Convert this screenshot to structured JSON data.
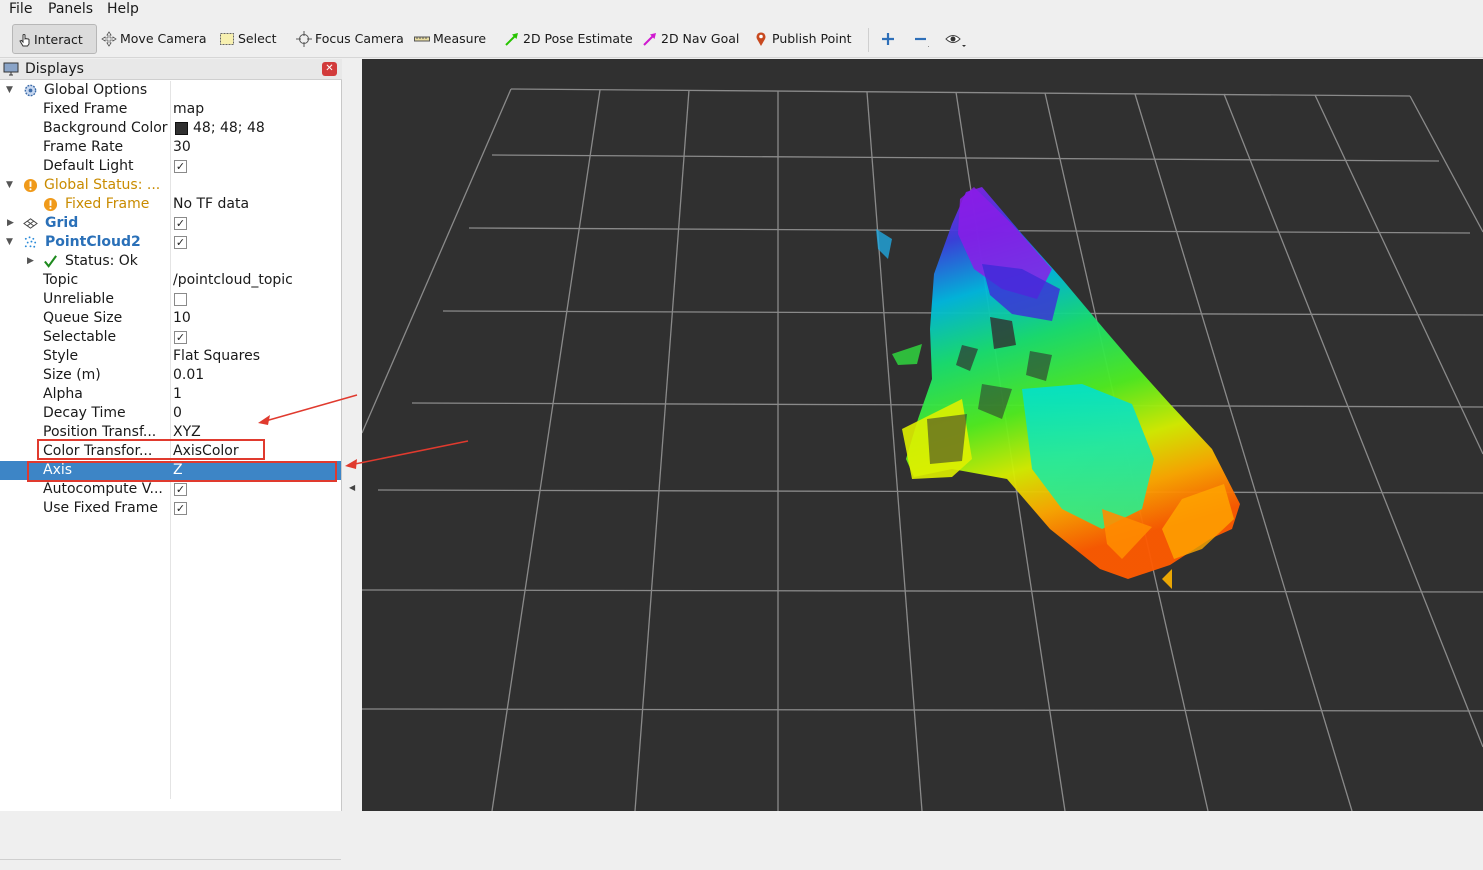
{
  "menu": [
    "File",
    "Panels",
    "Help"
  ],
  "toolbar": {
    "interact": "Interact",
    "move_camera": "Move Camera",
    "select": "Select",
    "focus_camera": "Focus Camera",
    "measure": "Measure",
    "pose_estimate": "2D Pose Estimate",
    "nav_goal": "2D Nav Goal",
    "publish_point": "Publish Point"
  },
  "displays": {
    "title": "Displays",
    "global_options": {
      "label": "Global Options",
      "fixed_frame_key": "Fixed Frame",
      "fixed_frame_val": "map",
      "bg_color_key": "Background Color",
      "bg_color_val": "48; 48; 48",
      "frame_rate_key": "Frame Rate",
      "frame_rate_val": "30",
      "default_light_key": "Default Light",
      "default_light_checked": true
    },
    "global_status": {
      "label": "Global Status: ...",
      "fixed_frame_key": "Fixed Frame",
      "fixed_frame_val": "No TF data"
    },
    "grid": {
      "label": "Grid",
      "checked": true
    },
    "pointcloud": {
      "label": "PointCloud2",
      "checked": true,
      "status": "Status: Ok",
      "topic_key": "Topic",
      "topic_val": "/pointcloud_topic",
      "unreliable_key": "Unreliable",
      "unreliable_checked": false,
      "queue_key": "Queue Size",
      "queue_val": "10",
      "selectable_key": "Selectable",
      "selectable_checked": true,
      "style_key": "Style",
      "style_val": "Flat Squares",
      "size_key": "Size (m)",
      "size_val": "0.01",
      "alpha_key": "Alpha",
      "alpha_val": "1",
      "decay_key": "Decay Time",
      "decay_val": "0",
      "pos_tf_key": "Position Transf...",
      "pos_tf_val": "XYZ",
      "color_tf_key": "Color Transfor...",
      "color_tf_val": "AxisColor",
      "axis_key": "Axis",
      "axis_val": "Z",
      "autocompute_key": "Autocompute V...",
      "autocompute_checked": true,
      "use_fixed_key": "Use Fixed Frame",
      "use_fixed_checked": true
    }
  },
  "colors": {
    "viewport_bg": "#303030",
    "selection": "#3d85c6",
    "annotation": "#e03a2e"
  }
}
